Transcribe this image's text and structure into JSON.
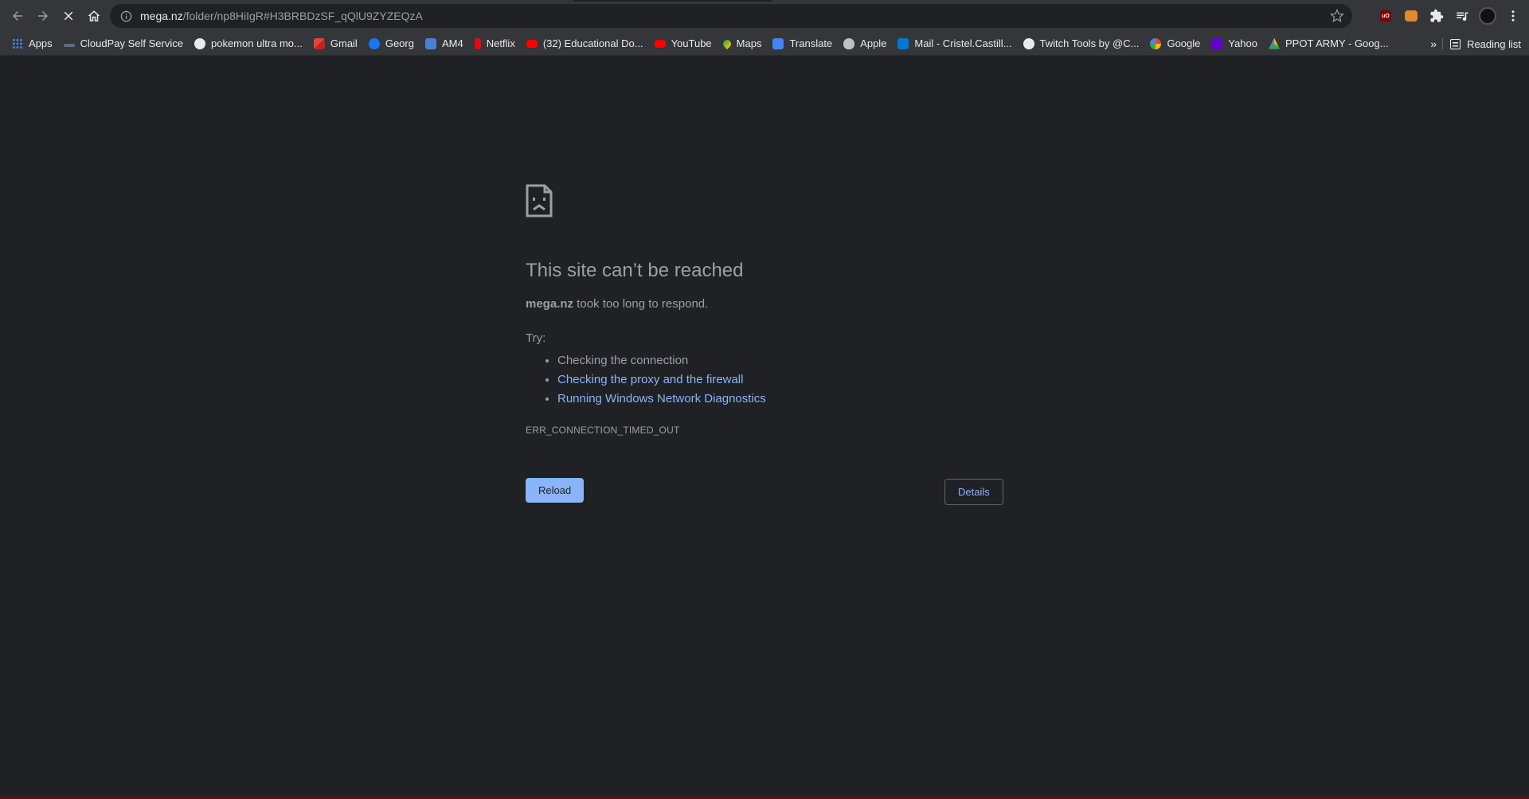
{
  "browser": {
    "url_host": "mega.nz",
    "url_path": "/folder/np8HiIgR#H3BRBDzSF_qQlU9ZYZEQzA",
    "nav": {
      "back": "back-arrow-icon",
      "forward": "forward-arrow-icon",
      "stop": "stop-x-icon",
      "home": "home-icon"
    },
    "extensions": [
      {
        "name": "ublock-origin",
        "label": "uO"
      },
      {
        "name": "tiger-extension",
        "label": ""
      }
    ]
  },
  "bookmarks": {
    "items": [
      {
        "label": "Apps",
        "icon": "apps-grid-icon"
      },
      {
        "label": "CloudPay Self Service",
        "icon": "cloudpay-icon"
      },
      {
        "label": "pokemon ultra mo...",
        "icon": "github-icon"
      },
      {
        "label": "Gmail",
        "icon": "gmail-icon"
      },
      {
        "label": "Georg",
        "icon": "facebook-icon"
      },
      {
        "label": "AM4",
        "icon": "am4-icon"
      },
      {
        "label": "Netflix",
        "icon": "netflix-icon"
      },
      {
        "label": "(32) Educational Do...",
        "icon": "youtube-icon"
      },
      {
        "label": "YouTube",
        "icon": "youtube-icon"
      },
      {
        "label": "Maps",
        "icon": "maps-icon"
      },
      {
        "label": "Translate",
        "icon": "translate-icon"
      },
      {
        "label": "Apple",
        "icon": "apple-icon"
      },
      {
        "label": "Mail - Cristel.Castill...",
        "icon": "outlook-icon"
      },
      {
        "label": "Twitch Tools by @C...",
        "icon": "twitch-tools-icon"
      },
      {
        "label": "Google",
        "icon": "google-icon"
      },
      {
        "label": "Yahoo",
        "icon": "yahoo-icon"
      },
      {
        "label": "PPOT ARMY - Goog...",
        "icon": "google-drive-icon"
      }
    ],
    "more": "»",
    "reading_list": "Reading list"
  },
  "error_page": {
    "heading": "This site can’t be reached",
    "host": "mega.nz",
    "summary_rest": " took too long to respond.",
    "try_label": "Try:",
    "suggestions": [
      "Checking the connection",
      "Checking the proxy and the firewall",
      "Running Windows Network Diagnostics"
    ],
    "error_code": "ERR_CONNECTION_TIMED_OUT",
    "reload_label": "Reload",
    "details_label": "Details"
  },
  "colors": {
    "background": "#202124",
    "toolbar": "#35363a",
    "text": "#9aa0a6",
    "link": "#8ab4f8",
    "button": "#8ab4f8"
  }
}
